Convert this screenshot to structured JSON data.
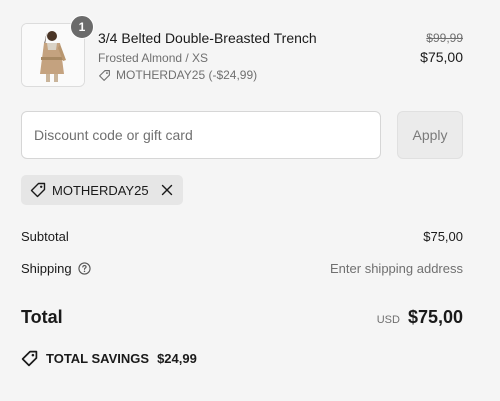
{
  "product": {
    "quantity": "1",
    "name": "3/4 Belted Double-Breasted Trench",
    "variant": "Frosted Almond / XS",
    "discount_line": "MOTHERDAY25 (-$24,99)",
    "price_original": "$99,99",
    "price_current": "$75,00",
    "image_icon": "product-photo"
  },
  "discount": {
    "placeholder": "Discount code or gift card",
    "value": "",
    "apply_label": "Apply",
    "applied_code": "MOTHERDAY25"
  },
  "summary": {
    "subtotal_label": "Subtotal",
    "subtotal_value": "$75,00",
    "shipping_label": "Shipping",
    "shipping_value": "Enter shipping address",
    "total_label": "Total",
    "currency": "USD",
    "total_value": "$75,00"
  },
  "savings": {
    "label": "TOTAL SAVINGS",
    "value": "$24,99"
  },
  "colors": {
    "background": "#f5f5f5",
    "text": "#1a1a1a",
    "muted": "#707070",
    "badge": "#6b6b6b"
  }
}
